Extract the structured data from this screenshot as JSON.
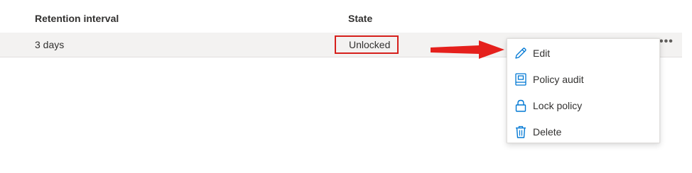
{
  "table": {
    "headers": {
      "retention": "Retention interval",
      "state": "State"
    },
    "rows": [
      {
        "retention": "3 days",
        "state": "Unlocked",
        "more": "•••"
      }
    ]
  },
  "context_menu": {
    "items": [
      {
        "label": "Edit",
        "icon": "pencil-icon"
      },
      {
        "label": "Policy audit",
        "icon": "audit-icon"
      },
      {
        "label": "Lock policy",
        "icon": "lock-icon"
      },
      {
        "label": "Delete",
        "icon": "trash-icon"
      }
    ]
  },
  "colors": {
    "accent": "#0078d4",
    "highlight": "#d6201c",
    "row_background": "#f3f2f1"
  }
}
